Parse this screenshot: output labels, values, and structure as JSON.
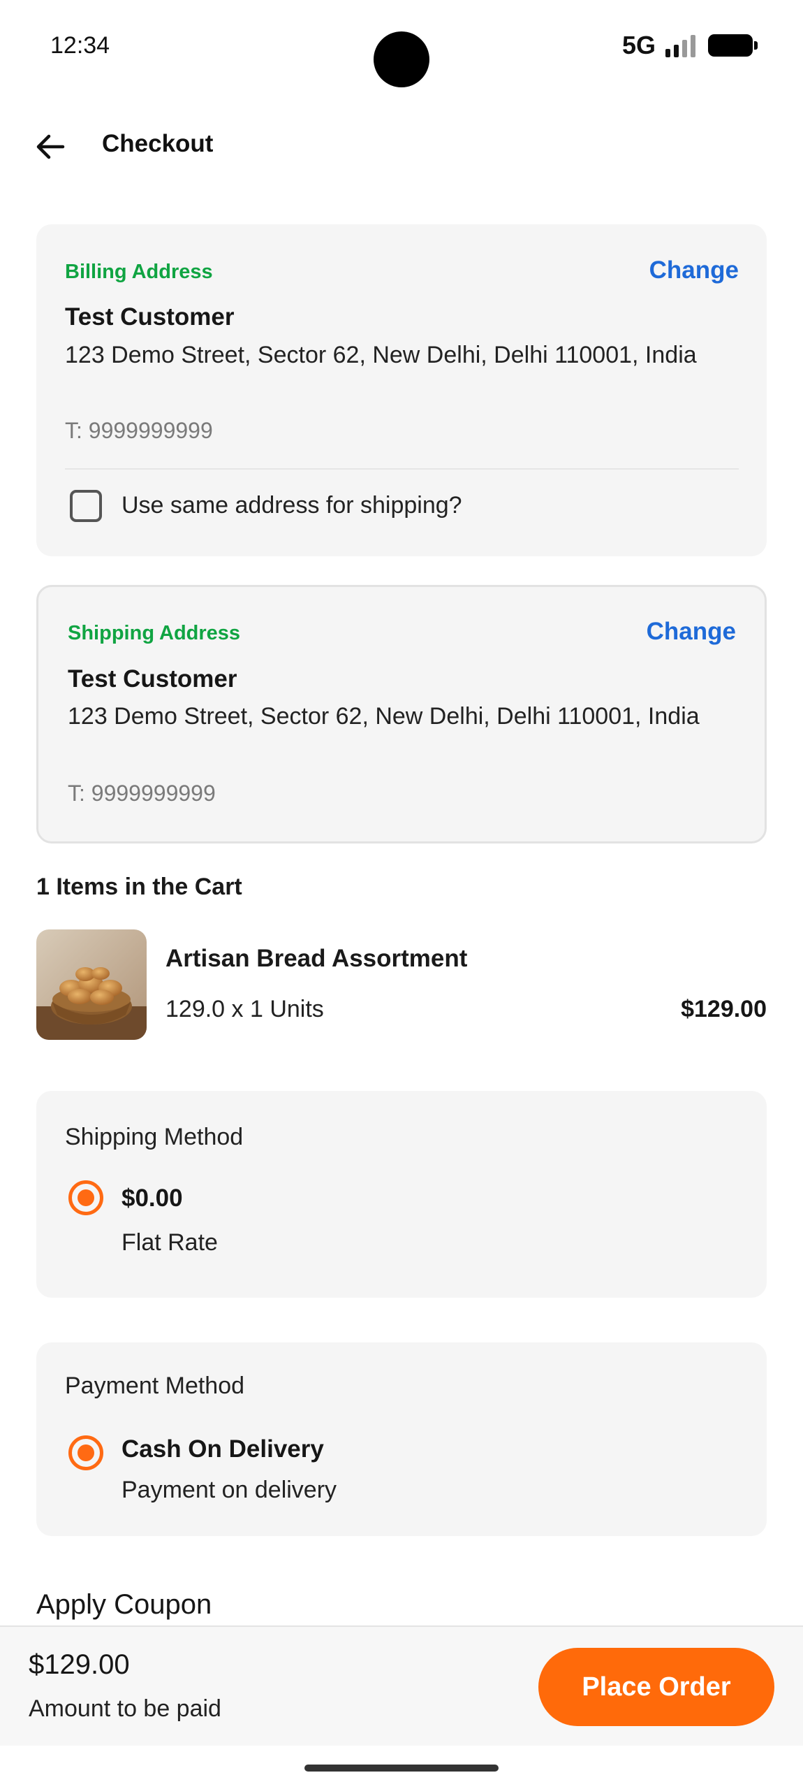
{
  "status_bar": {
    "time": "12:34",
    "network": "5G",
    "icons": [
      "camera-cutout",
      "signal-icon",
      "battery-icon"
    ]
  },
  "app_bar": {
    "back_icon": "arrow-left-icon",
    "title": "Checkout"
  },
  "billing": {
    "label": "Billing Address",
    "change_label": "Change",
    "name": "Test Customer",
    "address": "123 Demo Street, Sector 62, New Delhi, Delhi 110001, India",
    "phone": "T: 9999999999",
    "same_address_label": "Use same address for shipping?",
    "same_address_checked": false
  },
  "shipping": {
    "label": "Shipping Address",
    "change_label": "Change",
    "name": "Test Customer",
    "address": "123 Demo Street, Sector 62, New Delhi, Delhi 110001, India",
    "phone": "T: 9999999999"
  },
  "cart": {
    "heading": "1 Items in the Cart",
    "items": [
      {
        "name": "Artisan Bread Assortment",
        "quantity_text": "129.0 x 1 Units",
        "price": "$129.00",
        "image": "bread-basket-image"
      }
    ]
  },
  "shipping_method": {
    "title": "Shipping Method",
    "selected": {
      "price": "$0.00",
      "name": "Flat Rate"
    }
  },
  "payment_method": {
    "title": "Payment Method",
    "selected": {
      "name": "Cash On Delivery",
      "description": "Payment on delivery"
    }
  },
  "coupon": {
    "heading": "Apply Coupon"
  },
  "footer": {
    "total": "$129.00",
    "total_label": "Amount to be paid",
    "place_order_label": "Place Order"
  },
  "colors": {
    "accent_green": "#10a442",
    "link_blue": "#1e6ad8",
    "primary_orange": "#ff6a0a",
    "card_bg": "#f5f5f5"
  }
}
